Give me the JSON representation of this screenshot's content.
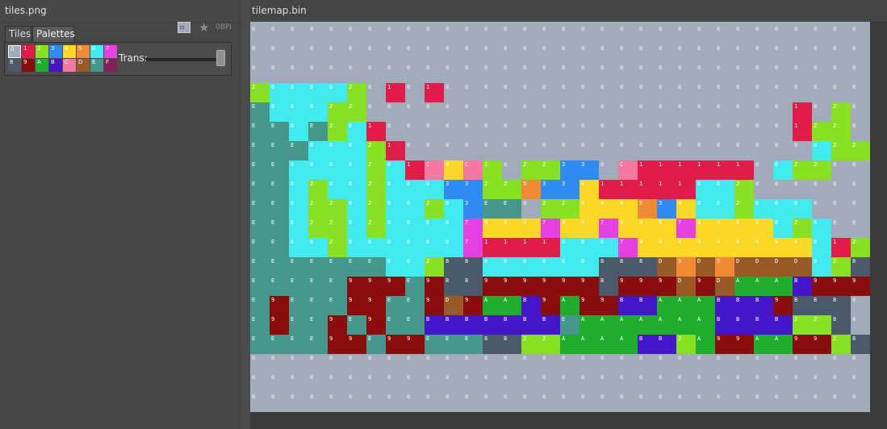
{
  "left_panel": {
    "title": "tiles.png",
    "bpp_label": "0BPI"
  },
  "right_panel": {
    "title": "tilemap.bin"
  },
  "tabs": [
    {
      "label": "Tiles"
    },
    {
      "label": "Palettes"
    }
  ],
  "palette": {
    "trans_label": "Trans:",
    "slider_value": 1.0,
    "selected_index": 0,
    "swatches": [
      {
        "label": "0",
        "color": "#a1abb9"
      },
      {
        "label": "1",
        "color": "#e21c4a"
      },
      {
        "label": "2",
        "color": "#87e021"
      },
      {
        "label": "3",
        "color": "#2f8bf1"
      },
      {
        "label": "4",
        "color": "#fcd826"
      },
      {
        "label": "5",
        "color": "#f08a34"
      },
      {
        "label": "6",
        "color": "#41eaee"
      },
      {
        "label": "7",
        "color": "#e440e2"
      },
      {
        "label": "8",
        "color": "#4a5a6a"
      },
      {
        "label": "9",
        "color": "#8a0d0d"
      },
      {
        "label": "A",
        "color": "#1fad2c"
      },
      {
        "label": "B",
        "color": "#4317c9"
      },
      {
        "label": "C",
        "color": "#f478a0"
      },
      {
        "label": "D",
        "color": "#9a5a26"
      },
      {
        "label": "E",
        "color": "#47968c"
      },
      {
        "label": "F",
        "color": "#861d5c"
      }
    ]
  },
  "tilemap": {
    "columns": 32,
    "rows": 20,
    "tile_colors": {
      "0": "#a1abb9",
      "1": "#e21c4a",
      "2": "#87e021",
      "3": "#2f8bf1",
      "4": "#fcd826",
      "5": "#f08a34",
      "6": "#41eaee",
      "7": "#e440e2",
      "8": "#4a5a6a",
      "9": "#8a0d0d",
      "A": "#1fad2c",
      "B": "#4317c9",
      "C": "#f478a0",
      "D": "#9a5a26",
      "E": "#47968c",
      "F": "#861d5c"
    },
    "grid": [
      "00000000000000000000000000000000",
      "00000000000000000000000000000000",
      "00000000000000000000000000000000",
      "26666201010000000000000000000000",
      "E6662200000000000000000000001020",
      "EE6E2610000000000000000000001220",
      "EEE66621000000000000000000000622",
      "EE6666261C4C2022330C1111110622",
      "EE626626663322533411111662",
      "EE6226266263EE022444534662666",
      "EE6226266667444744744474444626",
      "EE662666666711116667444444444612266",
      "EEEEEEE66288666666888D5D5DDDD6286666",
      "EEEEE999E9889999998999D9DAAAB99999999",
      "E9EEE99EE9D9AAB9A99BBAAABBB9888",
      "E9EE9E9EEBBBBBBBEAAAAAAABBBB228",
      "EEEE99E99EEE8822AAAABB2A99AA9928",
      "00000000000000000000000000000000",
      "00000000000000000000000000000000",
      "00000000000000000000000000000000"
    ]
  }
}
